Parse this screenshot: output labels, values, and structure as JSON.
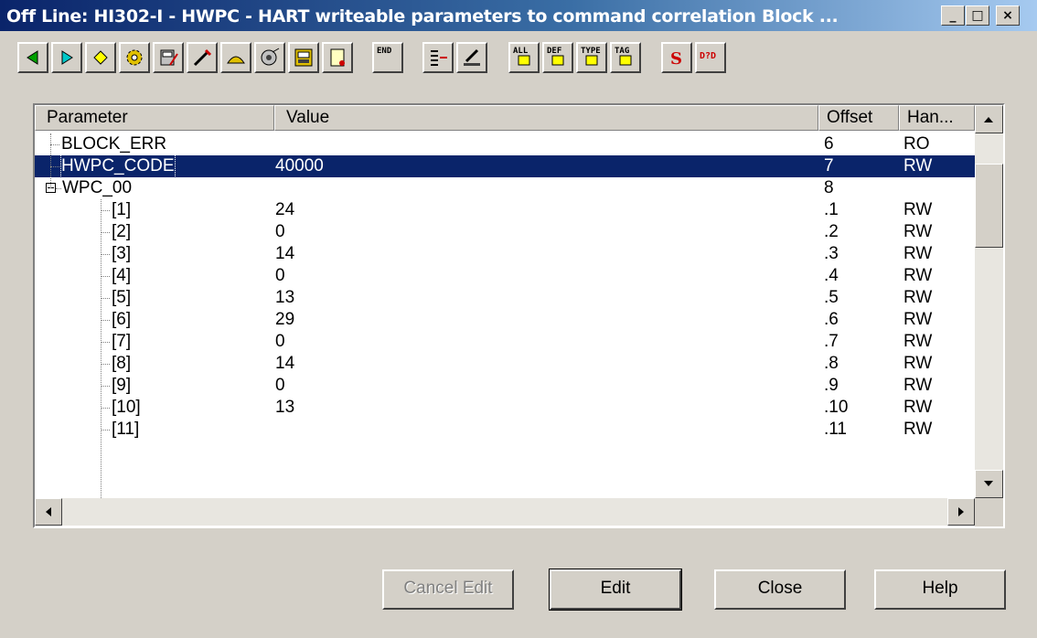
{
  "window": {
    "title": "Off Line: HI302-I - HWPC - HART writeable parameters to command correlation Block ...",
    "buttons": {
      "minimize": "_",
      "maximize": "□",
      "close": "×"
    }
  },
  "toolbar": {
    "tools": [
      {
        "name": "prev-icon"
      },
      {
        "name": "next-icon"
      },
      {
        "name": "diamond-icon"
      },
      {
        "name": "gears-icon"
      },
      {
        "name": "meter-icon"
      },
      {
        "name": "probe-icon"
      },
      {
        "name": "cap-icon"
      },
      {
        "name": "bell-icon"
      },
      {
        "name": "device-icon"
      },
      {
        "name": "scroll-icon"
      },
      {
        "name": "end-icon",
        "text": "END"
      },
      {
        "name": "list-arrow-icon"
      },
      {
        "name": "pen-icon"
      },
      {
        "name": "all-icon",
        "text": "ALL"
      },
      {
        "name": "def-icon",
        "text": "DEF"
      },
      {
        "name": "type-icon",
        "text": "TYPE"
      },
      {
        "name": "tag-icon",
        "text": "TAG"
      },
      {
        "name": "s-icon"
      },
      {
        "name": "dd-icon",
        "text": "D?D"
      }
    ]
  },
  "grid": {
    "columns": [
      "Parameter",
      "Value",
      "Offset",
      "Han..."
    ],
    "rows": [
      {
        "param": "BLOCK_ERR",
        "value": "",
        "offset": "6",
        "handling": "RO"
      },
      {
        "param": "HWPC_CODE",
        "value": "40000",
        "offset": "7",
        "handling": "RW"
      },
      {
        "param": "WPC_00",
        "value": "",
        "offset": "8",
        "handling": ""
      },
      {
        "param": "[1]",
        "value": "24",
        "offset": ".1",
        "handling": "RW"
      },
      {
        "param": "[2]",
        "value": "0",
        "offset": ".2",
        "handling": "RW"
      },
      {
        "param": "[3]",
        "value": "14",
        "offset": ".3",
        "handling": "RW"
      },
      {
        "param": "[4]",
        "value": "0",
        "offset": ".4",
        "handling": "RW"
      },
      {
        "param": "[5]",
        "value": "13",
        "offset": ".5",
        "handling": "RW"
      },
      {
        "param": "[6]",
        "value": "29",
        "offset": ".6",
        "handling": "RW"
      },
      {
        "param": "[7]",
        "value": "0",
        "offset": ".7",
        "handling": "RW"
      },
      {
        "param": "[8]",
        "value": "14",
        "offset": ".8",
        "handling": "RW"
      },
      {
        "param": "[9]",
        "value": "0",
        "offset": ".9",
        "handling": "RW"
      },
      {
        "param": "[10]",
        "value": "13",
        "offset": ".10",
        "handling": "RW"
      },
      {
        "param": "[11]",
        "value": "",
        "offset": ".11",
        "handling": "RW"
      }
    ],
    "selected_param": "HWPC_CODE",
    "expanded_node": "WPC_00"
  },
  "buttons": {
    "cancel_edit": "Cancel Edit",
    "edit": "Edit",
    "close": "Close",
    "help": "Help"
  },
  "colors": {
    "selection": "#0a246a",
    "face": "#d4d0c8"
  }
}
